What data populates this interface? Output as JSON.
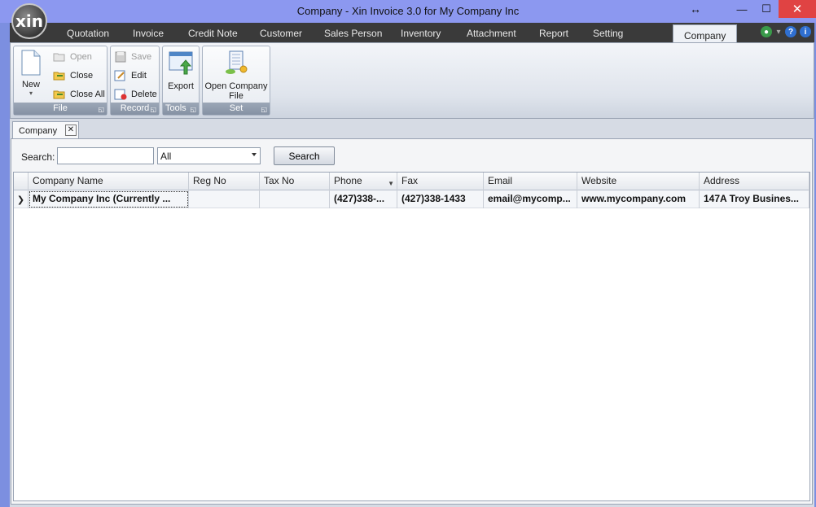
{
  "window": {
    "title": "Company - Xin Invoice 3.0 for My Company Inc",
    "logo_text": "xin"
  },
  "menu": {
    "tabs": [
      {
        "label": "Quotation"
      },
      {
        "label": "Invoice"
      },
      {
        "label": "Credit Note"
      },
      {
        "label": "Customer"
      },
      {
        "label": "Sales Person"
      },
      {
        "label": "Inventory"
      },
      {
        "label": "Attachment"
      },
      {
        "label": "Report"
      },
      {
        "label": "Setting"
      },
      {
        "label": "Company"
      }
    ],
    "active": "Company"
  },
  "ribbon": {
    "file": {
      "label": "File",
      "new": "New",
      "open": "Open",
      "close": "Close",
      "close_all": "Close All"
    },
    "record": {
      "label": "Record",
      "save": "Save",
      "edit": "Edit",
      "delete": "Delete"
    },
    "tools": {
      "label": "Tools",
      "export": "Export"
    },
    "set": {
      "label": "Set",
      "open_company_file_1": "Open Company",
      "open_company_file_2": "File"
    }
  },
  "document_tab": {
    "label": "Company"
  },
  "search": {
    "label": "Search:",
    "value": "",
    "filter_selected": "All",
    "button": "Search"
  },
  "grid": {
    "columns": [
      "Company Name",
      "Reg No",
      "Tax No",
      "Phone",
      "Fax",
      "Email",
      "Website",
      "Address"
    ],
    "rows": [
      [
        "My Company Inc (Currently ...",
        "",
        "",
        "(427)338-...",
        "(427)338-1433",
        "email@mycomp...",
        "www.mycompany.com",
        "147A Troy Busines..."
      ]
    ]
  }
}
